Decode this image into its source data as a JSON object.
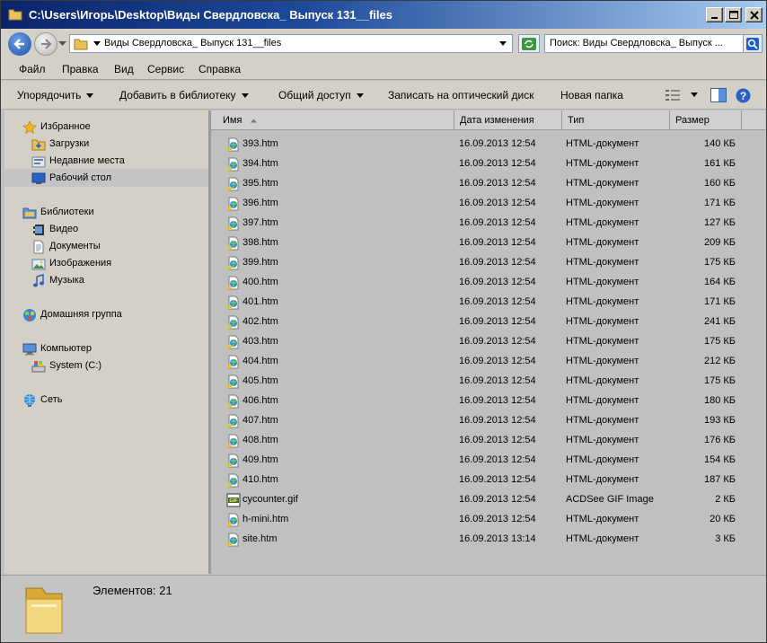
{
  "window": {
    "title": "C:\\Users\\Игорь\\Desktop\\Виды Свердловска_ Выпуск 131__files"
  },
  "address": {
    "path": "Виды Свердловска_ Выпуск 131__files"
  },
  "search": {
    "placeholder": "Поиск: Виды Свердловска_ Выпуск ..."
  },
  "menu": [
    "Файл",
    "Правка",
    "Вид",
    "Сервис",
    "Справка"
  ],
  "toolbar": {
    "organize": "Упорядочить",
    "add_library": "Добавить в библиотеку",
    "share": "Общий доступ",
    "burn": "Записать на оптический диск",
    "new_folder": "Новая папка"
  },
  "nav": {
    "favorites": "Избранное",
    "downloads": "Загрузки",
    "recent": "Недавние места",
    "desktop": "Рабочий стол",
    "libraries": "Библиотеки",
    "video": "Видео",
    "documents": "Документы",
    "images": "Изображения",
    "music": "Музыка",
    "homegroup": "Домашняя группа",
    "computer": "Компьютер",
    "system_drive": "System (C:)",
    "network": "Сеть"
  },
  "columns": {
    "name": "Имя",
    "date": "Дата изменения",
    "type": "Тип",
    "size": "Размер"
  },
  "files": [
    {
      "name": "393.htm",
      "date": "16.09.2013 12:54",
      "type": "HTML-документ",
      "size": "140 КБ",
      "icon": "html-file-icon"
    },
    {
      "name": "394.htm",
      "date": "16.09.2013 12:54",
      "type": "HTML-документ",
      "size": "161 КБ",
      "icon": "html-file-icon"
    },
    {
      "name": "395.htm",
      "date": "16.09.2013 12:54",
      "type": "HTML-документ",
      "size": "160 КБ",
      "icon": "html-file-icon"
    },
    {
      "name": "396.htm",
      "date": "16.09.2013 12:54",
      "type": "HTML-документ",
      "size": "171 КБ",
      "icon": "html-file-icon"
    },
    {
      "name": "397.htm",
      "date": "16.09.2013 12:54",
      "type": "HTML-документ",
      "size": "127 КБ",
      "icon": "html-file-icon"
    },
    {
      "name": "398.htm",
      "date": "16.09.2013 12:54",
      "type": "HTML-документ",
      "size": "209 КБ",
      "icon": "html-file-icon"
    },
    {
      "name": "399.htm",
      "date": "16.09.2013 12:54",
      "type": "HTML-документ",
      "size": "175 КБ",
      "icon": "html-file-icon"
    },
    {
      "name": "400.htm",
      "date": "16.09.2013 12:54",
      "type": "HTML-документ",
      "size": "164 КБ",
      "icon": "html-file-icon"
    },
    {
      "name": "401.htm",
      "date": "16.09.2013 12:54",
      "type": "HTML-документ",
      "size": "171 КБ",
      "icon": "html-file-icon"
    },
    {
      "name": "402.htm",
      "date": "16.09.2013 12:54",
      "type": "HTML-документ",
      "size": "241 КБ",
      "icon": "html-file-icon"
    },
    {
      "name": "403.htm",
      "date": "16.09.2013 12:54",
      "type": "HTML-документ",
      "size": "175 КБ",
      "icon": "html-file-icon"
    },
    {
      "name": "404.htm",
      "date": "16.09.2013 12:54",
      "type": "HTML-документ",
      "size": "212 КБ",
      "icon": "html-file-icon"
    },
    {
      "name": "405.htm",
      "date": "16.09.2013 12:54",
      "type": "HTML-документ",
      "size": "175 КБ",
      "icon": "html-file-icon"
    },
    {
      "name": "406.htm",
      "date": "16.09.2013 12:54",
      "type": "HTML-документ",
      "size": "180 КБ",
      "icon": "html-file-icon"
    },
    {
      "name": "407.htm",
      "date": "16.09.2013 12:54",
      "type": "HTML-документ",
      "size": "193 КБ",
      "icon": "html-file-icon"
    },
    {
      "name": "408.htm",
      "date": "16.09.2013 12:54",
      "type": "HTML-документ",
      "size": "176 КБ",
      "icon": "html-file-icon"
    },
    {
      "name": "409.htm",
      "date": "16.09.2013 12:54",
      "type": "HTML-документ",
      "size": "154 КБ",
      "icon": "html-file-icon"
    },
    {
      "name": "410.htm",
      "date": "16.09.2013 12:54",
      "type": "HTML-документ",
      "size": "187 КБ",
      "icon": "html-file-icon"
    },
    {
      "name": "cycounter.gif",
      "date": "16.09.2013 12:54",
      "type": "ACDSee GIF Image",
      "size": "2 КБ",
      "icon": "gif-file-icon"
    },
    {
      "name": "h-mini.htm",
      "date": "16.09.2013 12:54",
      "type": "HTML-документ",
      "size": "20 КБ",
      "icon": "html-file-icon"
    },
    {
      "name": "site.htm",
      "date": "16.09.2013 13:14",
      "type": "HTML-документ",
      "size": "3 КБ",
      "icon": "html-file-icon"
    }
  ],
  "status": {
    "count": "Элементов: 21"
  },
  "colors": {
    "title_start": "#0a246a",
    "title_end": "#a6caf0",
    "folder": "#e8c25a"
  }
}
